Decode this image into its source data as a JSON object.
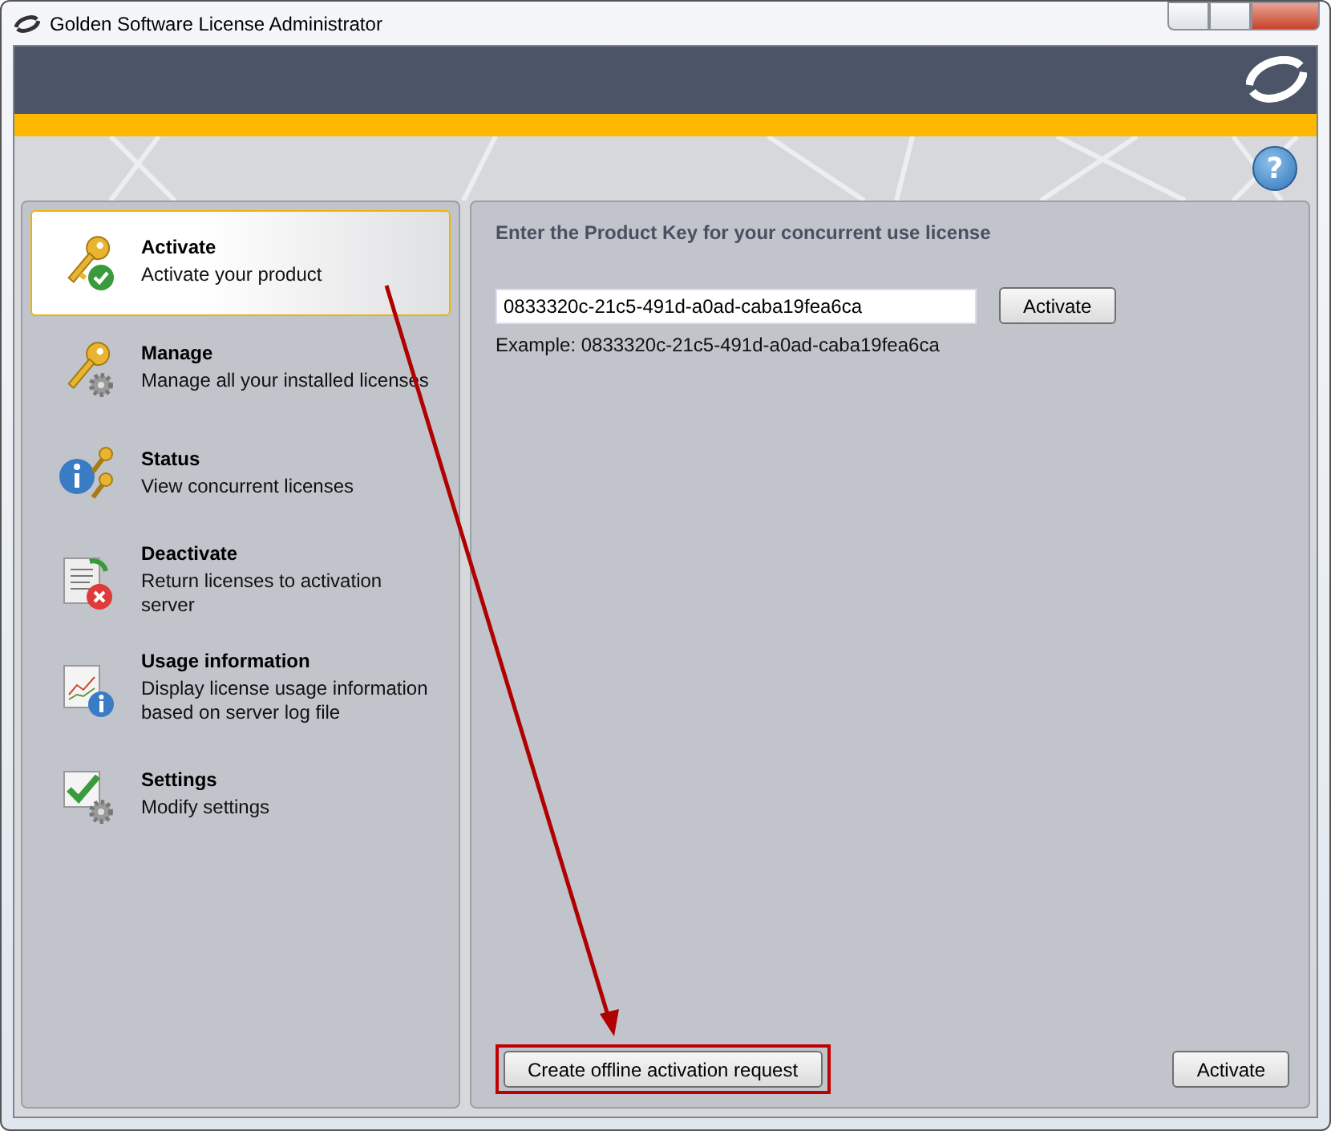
{
  "window": {
    "title": "Golden Software License Administrator"
  },
  "sidebar": {
    "items": [
      {
        "title": "Activate",
        "subtitle": "Activate your product",
        "selected": true
      },
      {
        "title": "Manage",
        "subtitle": "Manage all your installed licenses",
        "selected": false
      },
      {
        "title": "Status",
        "subtitle": "View concurrent licenses",
        "selected": false
      },
      {
        "title": "Deactivate",
        "subtitle": "Return licenses to activation server",
        "selected": false
      },
      {
        "title": "Usage information",
        "subtitle": "Display license usage information based on server log file",
        "selected": false
      },
      {
        "title": "Settings",
        "subtitle": "Modify settings",
        "selected": false
      }
    ]
  },
  "main": {
    "heading": "Enter the Product Key for your concurrent use license",
    "product_key": {
      "value": "0833320c-21c5-491d-a0ad-caba19fea6ca"
    },
    "activate_button": "Activate",
    "example": "Example: 0833320c-21c5-491d-a0ad-caba19fea6ca",
    "offline_button": "Create offline activation request",
    "bottom_button": "Activate"
  },
  "help_button": "?"
}
